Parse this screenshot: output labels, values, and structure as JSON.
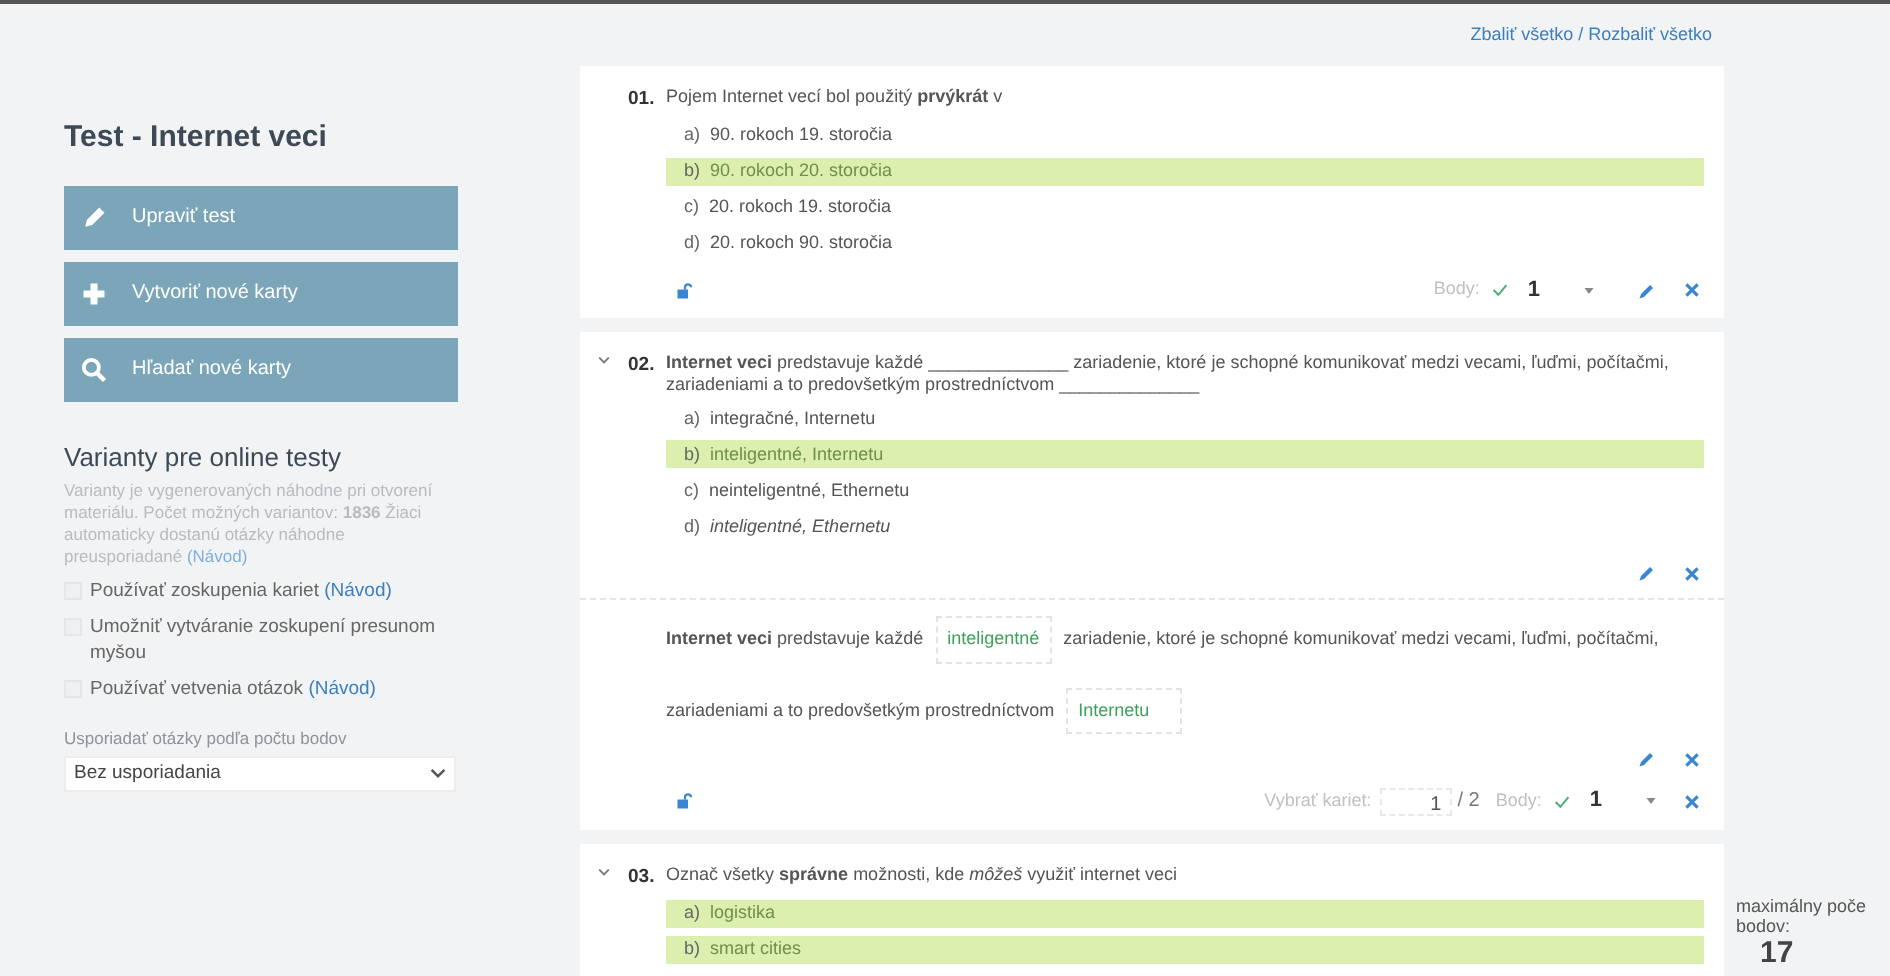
{
  "sidebar": {
    "title": "Test - Internet veci",
    "actions": [
      {
        "kind": "edit",
        "label": "Upraviť test"
      },
      {
        "kind": "add",
        "label": "Vytvoriť nové karty"
      },
      {
        "kind": "search",
        "label": "Hľadať nové karty"
      }
    ],
    "variants": {
      "heading": "Varianty pre online testy",
      "description": "Varianty je vygenerovaných náhodne pri otvorení materiálu. Počet možných variantov: **1836** Žiaci automaticky dostanú otázky náhodne preusporiadané",
      "description_link": "(Návod)",
      "options": [
        {
          "label": "Používať zoskupenia kariet",
          "link": "(Návod)",
          "checked": false
        },
        {
          "label": "Umožniť vytváranie zoskupení presunom myšou",
          "checked": false
        },
        {
          "label": "Používať vetvenia otázok",
          "link": "(Návod)",
          "checked": false
        }
      ],
      "sort_label": "Usporiadať otázky podľa počtu bodov",
      "sort_value": "Bez usporiadania"
    }
  },
  "toggle_all": "Zbaliť všetko / Rozbaliť všetko",
  "questions": [
    {
      "number": "01.",
      "toggle": false,
      "text": "Pojem Internet vecí bol použitý **prvýkrát** v",
      "options": [
        {
          "letter": "a)",
          "text": "90. rokoch 19. storočia",
          "correct": false
        },
        {
          "letter": "b)",
          "text": "90. rokoch 20. storočia",
          "correct": true
        },
        {
          "letter": "c)",
          "text": "20. rokoch 19. storočia",
          "correct": false
        },
        {
          "letter": "d)",
          "text": "20. rokoch 90. storočia",
          "correct": false
        }
      ],
      "footer": {
        "points_label": "Body:",
        "points": "1"
      }
    },
    {
      "number": "02.",
      "toggle": true,
      "text": "**Internet veci** predstavuje každé ______________ zariadenie, ktoré je schopné komunikovať medzi vecami, ľuďmi, počítačmi, zariadeniami a to predovšetkým prostredníctvom ______________",
      "options": [
        {
          "letter": "a)",
          "text": "integračné, Internetu",
          "correct": false
        },
        {
          "letter": "b)",
          "text": "inteligentné, Internetu",
          "correct": true
        },
        {
          "letter": "c)",
          "text": "neinteligentné, Ethernetu",
          "correct": false
        },
        {
          "letter": "d)",
          "text": "inteligentné, Ethernetu",
          "correct": false,
          "italic": true
        }
      ],
      "fill_in": [
        {
          "kind": "text",
          "text": "**Internet veci** predstavuje každé"
        },
        {
          "kind": "field",
          "value": "inteligentné"
        },
        {
          "kind": "text",
          "text": "zariadenie, ktoré je schopné komunikovať medzi vecami, ľuďmi, počítačmi,"
        },
        {
          "kind": "text",
          "text": "zariadeniami a to predovšetkým prostredníctvom"
        },
        {
          "kind": "field",
          "value": "Internetu"
        }
      ],
      "footer": {
        "cards_label": "Vybrať kariet:",
        "cards_value": "1",
        "cards_total": "/ 2",
        "points_label": "Body:",
        "points": "1"
      }
    },
    {
      "number": "03.",
      "toggle": true,
      "text": "Označ všetky **správne** možnosti, kde *môžeš* využiť internet veci",
      "options": [
        {
          "letter": "a)",
          "text": "logistika",
          "correct": true
        },
        {
          "letter": "b)",
          "text": "smart cities",
          "correct": true
        }
      ]
    }
  ],
  "max_points": {
    "label": "maximálny poče bodov:",
    "value": "17"
  }
}
